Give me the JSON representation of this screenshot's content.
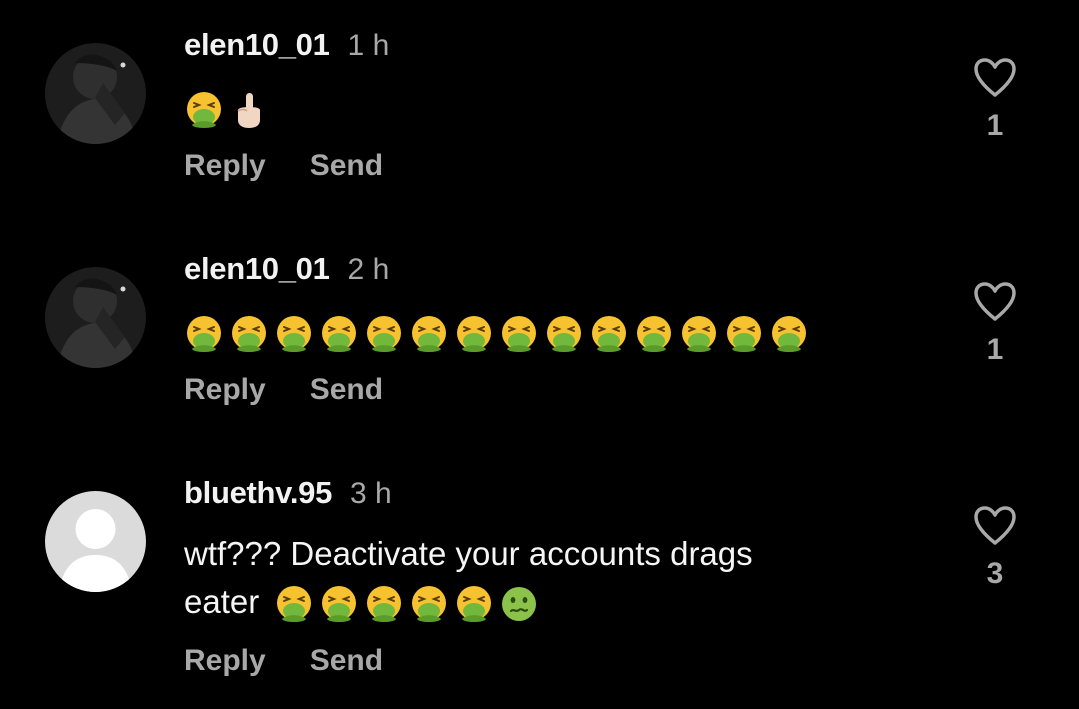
{
  "comments": [
    {
      "username": "elen10_01",
      "time": "1 h",
      "text": "",
      "emojis": [
        "face-vomiting",
        "middle-finger"
      ],
      "likes": "1",
      "reply_label": "Reply",
      "send_label": "Send"
    },
    {
      "username": "elen10_01",
      "time": "2 h",
      "text": "",
      "emojis": [
        "face-vomiting",
        "face-vomiting",
        "face-vomiting",
        "face-vomiting",
        "face-vomiting",
        "face-vomiting",
        "face-vomiting",
        "face-vomiting",
        "face-vomiting",
        "face-vomiting",
        "face-vomiting",
        "face-vomiting",
        "face-vomiting",
        "face-vomiting"
      ],
      "likes": "1",
      "reply_label": "Reply",
      "send_label": "Send"
    },
    {
      "username": "bluethv.95",
      "time": "3 h",
      "text_line1": "wtf??? Deactivate your accounts drags",
      "text_line2": "eater",
      "emojis": [
        "face-vomiting",
        "face-vomiting",
        "face-vomiting",
        "face-vomiting",
        "face-vomiting",
        "nauseated-face"
      ],
      "likes": "3",
      "reply_label": "Reply",
      "send_label": "Send"
    }
  ],
  "colors": {
    "background": "#000000",
    "username": "#f2f2f2",
    "secondary": "#a8a8a8",
    "body": "#f5f5f5"
  },
  "icons": {
    "like": "heart-outline-icon",
    "avatar_default": "default-avatar-icon"
  }
}
